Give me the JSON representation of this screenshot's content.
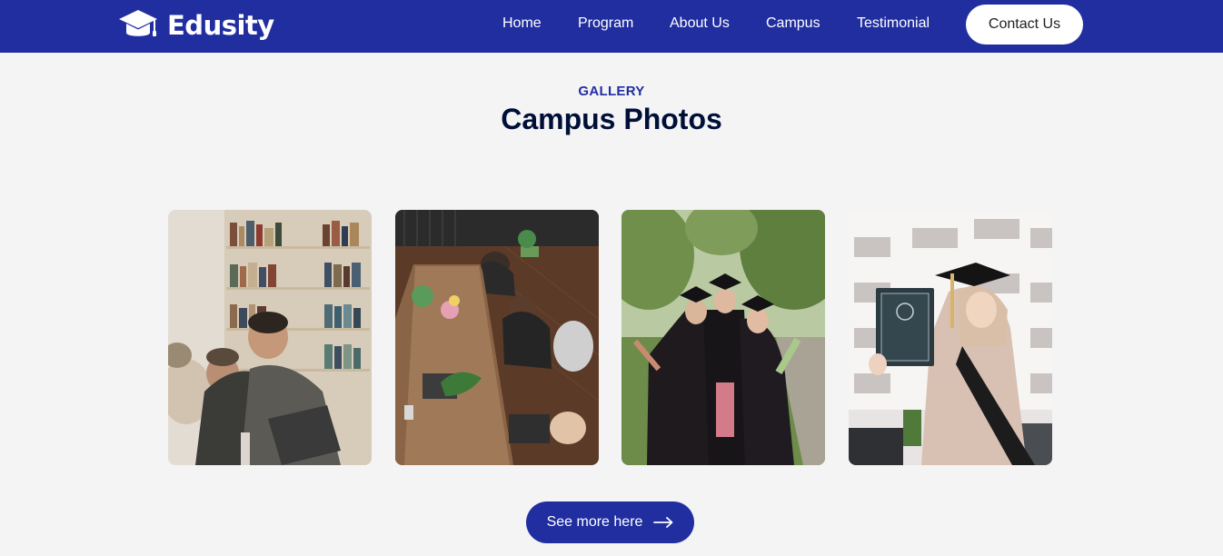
{
  "brand": {
    "name": "Edusity",
    "logo_icon": "graduation-cap-icon"
  },
  "nav": {
    "items": [
      {
        "label": "Home"
      },
      {
        "label": "Program"
      },
      {
        "label": "About Us"
      },
      {
        "label": "Campus"
      },
      {
        "label": "Testimonial"
      }
    ],
    "contact_label": "Contact Us"
  },
  "section": {
    "subtitle": "GALLERY",
    "title": "Campus Photos"
  },
  "gallery": {
    "photos": [
      {
        "subject": "students laughing at a laptop in a library"
      },
      {
        "subject": "people working at a long wooden table with laptops"
      },
      {
        "subject": "three graduates in caps and gowns outdoors"
      },
      {
        "subject": "graduate holding a diploma in front of a building"
      }
    ]
  },
  "cta": {
    "label": "See more here",
    "icon": "arrow-right-icon"
  },
  "colors": {
    "primary": "#212ea0",
    "background": "#f4f4f5",
    "title": "#000f38",
    "white": "#ffffff"
  }
}
